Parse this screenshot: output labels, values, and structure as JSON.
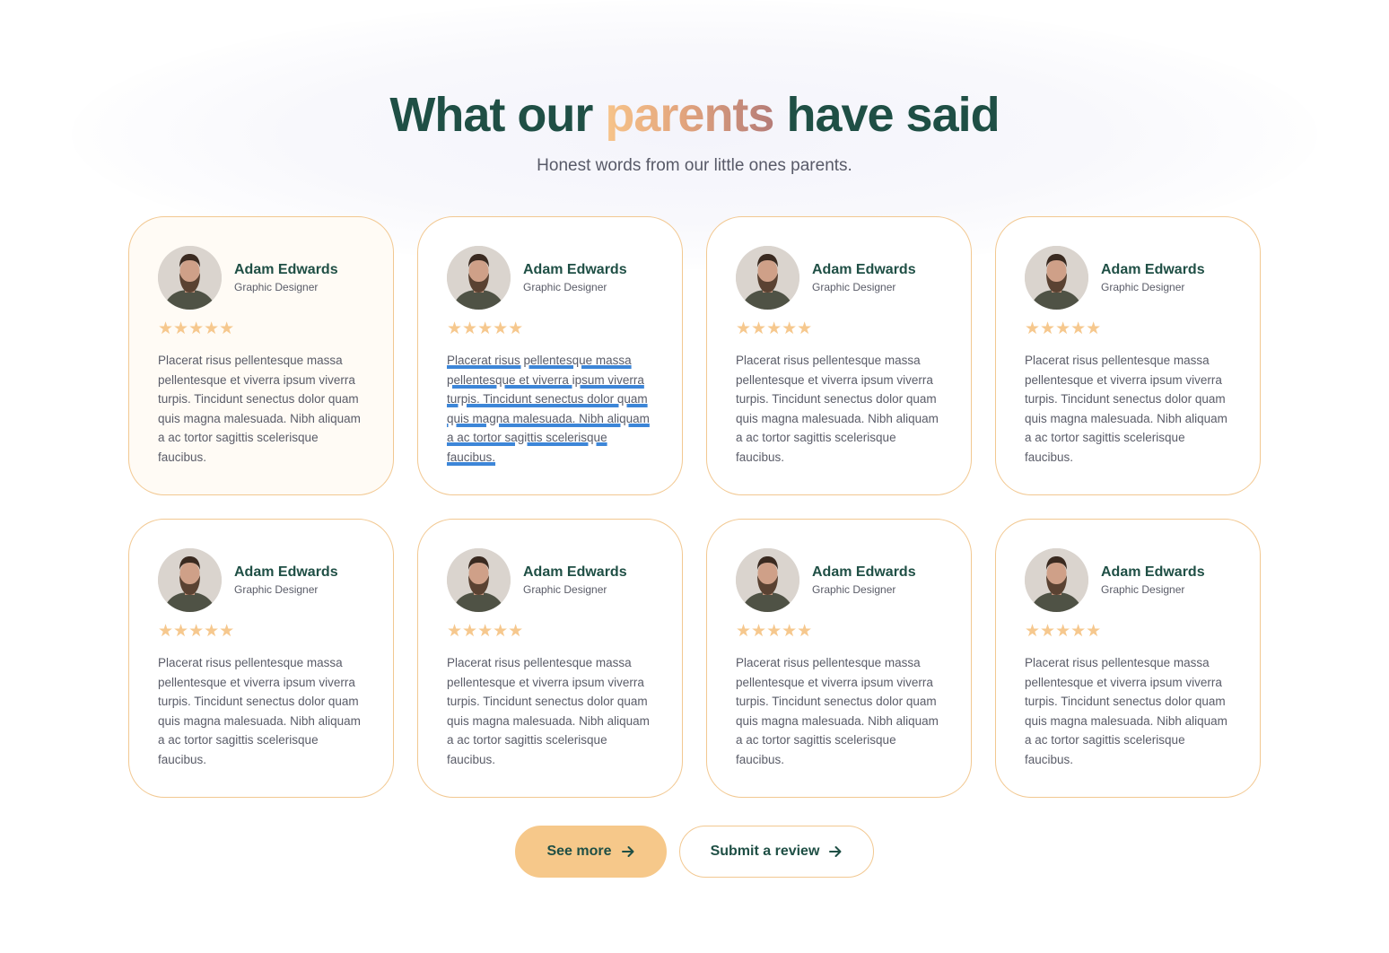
{
  "header": {
    "title_before": "What our",
    "title_accent": "parents",
    "title_after": "have said",
    "subtitle": "Honest words from our little ones parents."
  },
  "testimonials": [
    {
      "name": "Adam Edwards",
      "role": "Graphic Designer",
      "rating": 5,
      "stars": "★★★★★",
      "text": "Placerat risus pellentesque massa pellentesque et viverra ipsum viverra turpis. Tincidunt senectus dolor quam quis magna malesuada. Nibh aliquam a ac tortor sagittis scelerisque faucibus."
    },
    {
      "name": "Adam Edwards",
      "role": "Graphic Designer",
      "rating": 5,
      "stars": "★★★★★",
      "text": "Placerat risus pellentesque massa pellentesque et viverra ipsum viverra turpis. Tincidunt senectus dolor quam quis magna malesuada. Nibh aliquam a ac tortor sagittis scelerisque faucibus."
    },
    {
      "name": "Adam Edwards",
      "role": "Graphic Designer",
      "rating": 5,
      "stars": "★★★★★",
      "text": "Placerat risus pellentesque massa pellentesque et viverra ipsum viverra turpis. Tincidunt senectus dolor quam quis magna malesuada. Nibh aliquam a ac tortor sagittis scelerisque faucibus."
    },
    {
      "name": "Adam Edwards",
      "role": "Graphic Designer",
      "rating": 5,
      "stars": "★★★★★",
      "text": "Placerat risus pellentesque massa pellentesque et viverra ipsum viverra turpis. Tincidunt senectus dolor quam quis magna malesuada. Nibh aliquam a ac tortor sagittis scelerisque faucibus."
    },
    {
      "name": "Adam Edwards",
      "role": "Graphic Designer",
      "rating": 5,
      "stars": "★★★★★",
      "text": "Placerat risus pellentesque massa pellentesque et viverra ipsum viverra turpis. Tincidunt senectus dolor quam quis magna malesuada. Nibh aliquam a ac tortor sagittis scelerisque faucibus."
    },
    {
      "name": "Adam Edwards",
      "role": "Graphic Designer",
      "rating": 5,
      "stars": "★★★★★",
      "text": "Placerat risus pellentesque massa pellentesque et viverra ipsum viverra turpis. Tincidunt senectus dolor quam quis magna malesuada. Nibh aliquam a ac tortor sagittis scelerisque faucibus."
    },
    {
      "name": "Adam Edwards",
      "role": "Graphic Designer",
      "rating": 5,
      "stars": "★★★★★",
      "text": "Placerat risus pellentesque massa pellentesque et viverra ipsum viverra turpis. Tincidunt senectus dolor quam quis magna malesuada. Nibh aliquam a ac tortor sagittis scelerisque faucibus."
    },
    {
      "name": "Adam Edwards",
      "role": "Graphic Designer",
      "rating": 5,
      "stars": "★★★★★",
      "text": "Placerat risus pellentesque massa pellentesque et viverra ipsum viverra turpis. Tincidunt senectus dolor quam quis magna malesuada. Nibh aliquam a ac tortor sagittis scelerisque faucibus."
    }
  ],
  "actions": {
    "see_more_label": "See more",
    "submit_review_label": "Submit a review",
    "arrow_icon": "arrow-right-icon"
  },
  "colors": {
    "heading": "#1f4f45",
    "accent_start": "#f7c48a",
    "accent_end": "#b57c78",
    "card_border": "#f2c891",
    "star": "#f6c88e",
    "primary_button": "#f6c88a",
    "text_selection_underline": "#3d86d8"
  }
}
